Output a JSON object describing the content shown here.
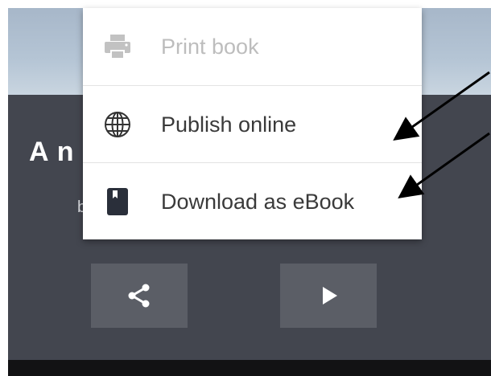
{
  "book": {
    "title": "A n",
    "byline": "b"
  },
  "menu": {
    "items": [
      {
        "label": "Print book",
        "icon": "printer-icon",
        "enabled": false
      },
      {
        "label": "Publish online",
        "icon": "globe-icon",
        "enabled": true
      },
      {
        "label": "Download as eBook",
        "icon": "ebook-icon",
        "enabled": true
      }
    ]
  },
  "actions": {
    "share_icon": "share-icon",
    "play_icon": "play-icon"
  },
  "colors": {
    "background": "#43464f",
    "menu_bg": "#ffffff",
    "disabled_text": "#bdbdbd",
    "text": "#3a3a3a",
    "button_bg": "#5b5e66"
  }
}
